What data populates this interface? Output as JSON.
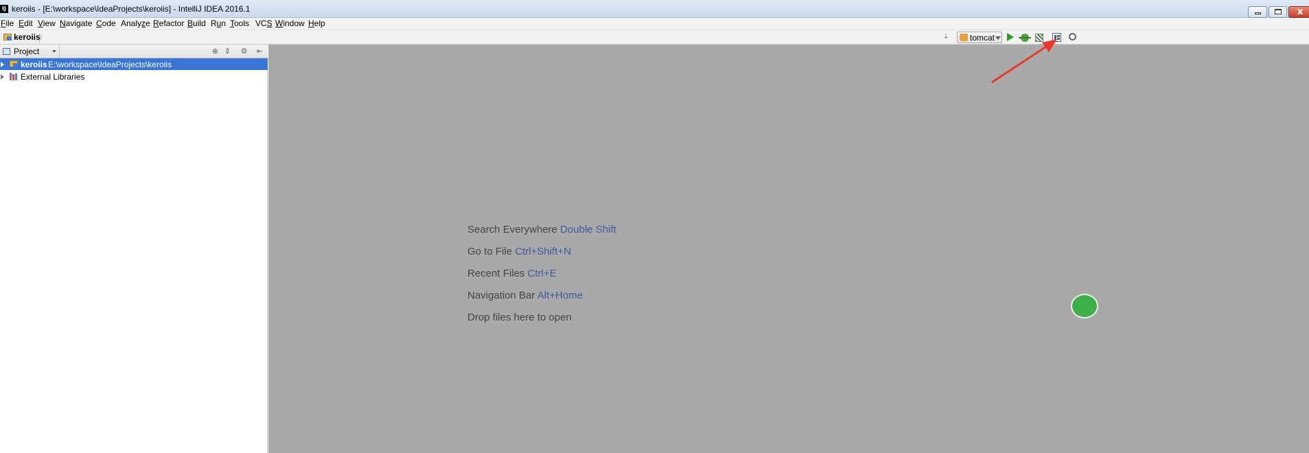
{
  "window": {
    "title": "keroiis - [E:\\workspace\\IdeaProjects\\keroiis] - IntelliJ IDEA 2016.1",
    "app_icon_text": "IJ",
    "close_glyph": "x"
  },
  "menu": {
    "items": [
      {
        "u": "F",
        "rest": "ile"
      },
      {
        "u": "E",
        "rest": "dit"
      },
      {
        "u": "V",
        "rest": "iew"
      },
      {
        "u": "N",
        "rest": "avigate"
      },
      {
        "u": "C",
        "rest": "ode"
      },
      {
        "pre": "Analy",
        "u": "z",
        "rest": "e"
      },
      {
        "u": "R",
        "rest": "efactor"
      },
      {
        "u": "B",
        "rest": "uild"
      },
      {
        "pre": "R",
        "u": "u",
        "rest": "n"
      },
      {
        "u": "T",
        "rest": "ools"
      },
      {
        "pre": "VC",
        "u": "S",
        "rest": ""
      },
      {
        "u": "W",
        "rest": "indow"
      },
      {
        "u": "H",
        "rest": "elp"
      }
    ]
  },
  "navbar": {
    "breadcrumb": "keroiis",
    "separator": "〉",
    "sort_glyph": "⇣",
    "run_config": "tomcat",
    "icons": [
      "folder-icon",
      "sort-icon",
      "run-icon",
      "debug-icon",
      "coverage-icon",
      "project-structure-icon",
      "search-icon"
    ]
  },
  "project_panel": {
    "view_label": "Project",
    "header_buttons": [
      "⊕",
      "⇕",
      "⚙",
      "⇤"
    ],
    "tree": [
      {
        "name": "keroiis",
        "path": "E:\\workspace\\IdeaProjects\\keroiis",
        "selected": true
      },
      {
        "name": "External Libraries",
        "path": "",
        "selected": false
      }
    ]
  },
  "editor_hints": [
    {
      "text": "Search Everywhere",
      "key": "Double Shift"
    },
    {
      "text": "Go to File",
      "key": "Ctrl+Shift+N"
    },
    {
      "text": "Recent Files",
      "key": "Ctrl+E"
    },
    {
      "text": "Navigation Bar",
      "key": "Alt+Home"
    },
    {
      "text": "Drop files here to open",
      "key": ""
    }
  ],
  "colors": {
    "selection": "#3875d7",
    "editor_bg": "#a9a9a9",
    "hint_key": "#3f5b9e",
    "annotation_arrow": "#e8392a"
  }
}
